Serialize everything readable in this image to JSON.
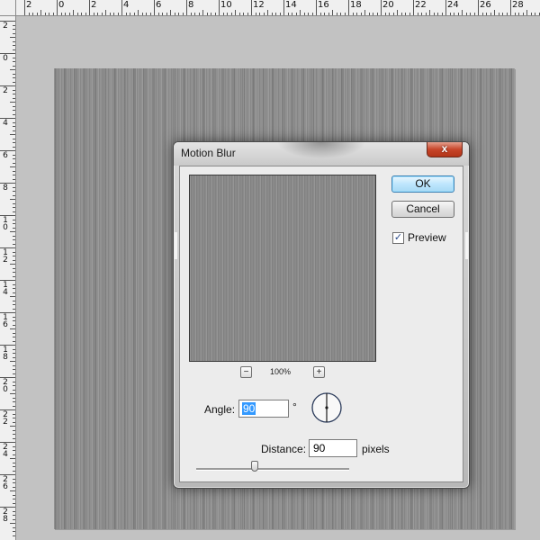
{
  "rulers": {
    "top_labels": [
      "2",
      "0",
      "2",
      "4",
      "6",
      "8",
      "10",
      "12",
      "14",
      "16",
      "18",
      "20",
      "22",
      "24",
      "26",
      "28"
    ],
    "left_labels": [
      "2",
      "0",
      "2",
      "4",
      "6",
      "8",
      "10",
      "12",
      "14",
      "16",
      "18",
      "20",
      "22",
      "24",
      "26",
      "28"
    ]
  },
  "dialog": {
    "title": "Motion Blur",
    "close_glyph": "x",
    "ok_label": "OK",
    "cancel_label": "Cancel",
    "preview_checkbox": {
      "label": "Preview",
      "checked": true,
      "check_glyph": "✓"
    },
    "zoom": {
      "minus_glyph": "−",
      "plus_glyph": "+",
      "level": "100%"
    },
    "angle": {
      "label": "Angle:",
      "value": "90",
      "unit": "°",
      "dial_angle_deg": 90
    },
    "distance": {
      "label": "Distance:",
      "value": "90",
      "unit": "pixels",
      "slider_fraction": 0.38
    }
  },
  "colors": {
    "canvas": "#8a8a8a",
    "workspace": "#c2c2c2",
    "ok_accent": "#3c7fb1",
    "close_red": "#c7452a",
    "selection": "#3399ff"
  }
}
